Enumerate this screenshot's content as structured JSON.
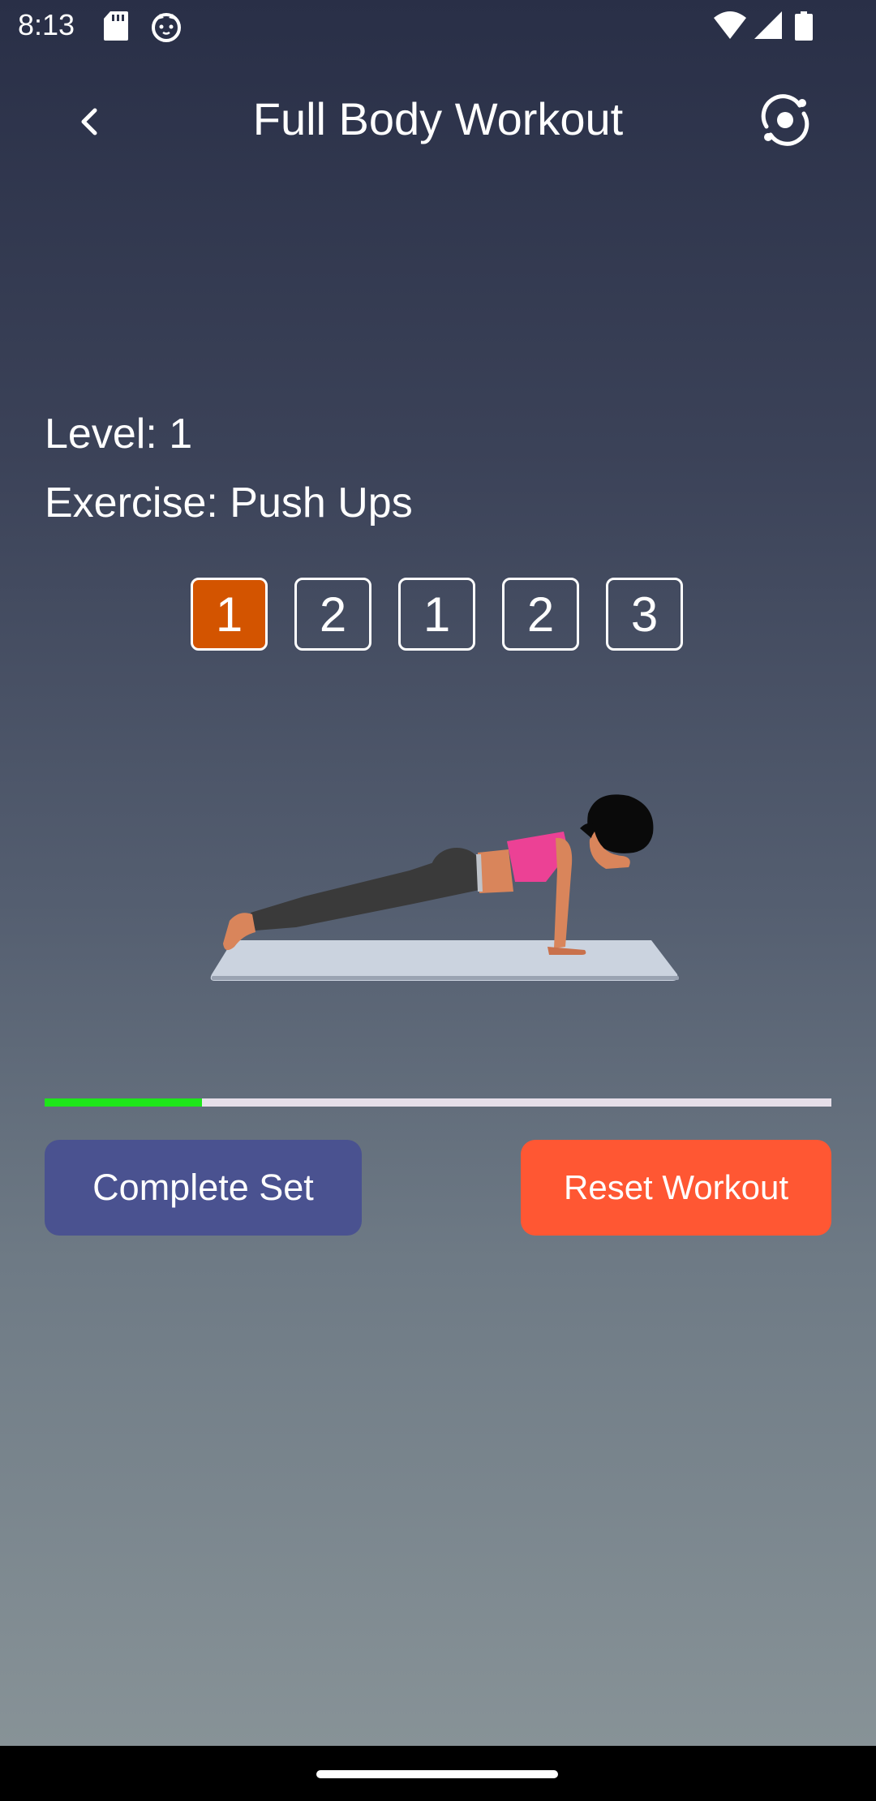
{
  "status_bar": {
    "time": "8:13",
    "icons": [
      "sd-card-icon",
      "cat-notification-icon",
      "wifi-icon",
      "signal-icon",
      "battery-icon"
    ]
  },
  "app_bar": {
    "title": "Full Body Workout",
    "back_icon": "chevron-left-icon",
    "action_icon": "sync-icon"
  },
  "workout": {
    "level_text": "Level: 1",
    "exercise_text": "Exercise: Push Ups",
    "sets": [
      "1",
      "2",
      "1",
      "2",
      "3"
    ],
    "active_set_index": 0,
    "illustration": "push-up-plank-illustration",
    "progress_fraction": 0.2
  },
  "actions": {
    "complete_label": "Complete Set",
    "reset_label": "Reset Workout"
  },
  "colors": {
    "active_set": "#d35400",
    "progress": "#1ee61a",
    "complete_button": "#4a5290",
    "reset_button": "#ff5733"
  }
}
